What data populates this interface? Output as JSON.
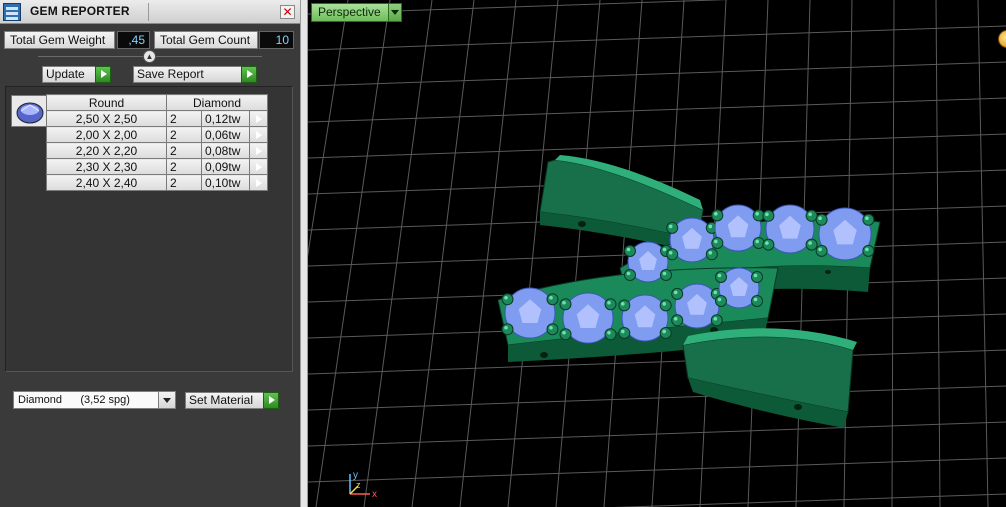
{
  "window": {
    "title": "GEM REPORTER",
    "close_glyph": "✕"
  },
  "stats": {
    "weight_label": "Total Gem Weight",
    "weight_value": ",45",
    "count_label": "Total Gem Count",
    "count_value": "10"
  },
  "buttons": {
    "update": "Update",
    "save_report": "Save Report",
    "set_material": "Set Material"
  },
  "table": {
    "header_cut": "Round",
    "header_type": "Diamond",
    "rows": [
      {
        "size": "2,50 X 2,50",
        "count": "2",
        "weight": "0,12tw"
      },
      {
        "size": "2,00 X 2,00",
        "count": "2",
        "weight": "0,06tw"
      },
      {
        "size": "2,20 X 2,20",
        "count": "2",
        "weight": "0,08tw"
      },
      {
        "size": "2,30 X 2,30",
        "count": "2",
        "weight": "0,09tw"
      },
      {
        "size": "2,40 X 2,40",
        "count": "2",
        "weight": "0,10tw"
      }
    ]
  },
  "material": {
    "selected": "Diamond      (3,52 spg)"
  },
  "viewport": {
    "view_label": "Perspective",
    "axes": {
      "x": "x",
      "y": "y",
      "z": "z"
    },
    "colors": {
      "metal": "#1c8a5a",
      "metal_dark": "#0d5a38",
      "gem": "#7f9cf0",
      "grid": "#5a5a5a"
    }
  },
  "icons": {
    "app": "gem-reporter-icon",
    "close": "close-icon",
    "play": "play-icon",
    "dropdown": "chevron-down-icon",
    "nav": "navigation-orb-icon"
  }
}
